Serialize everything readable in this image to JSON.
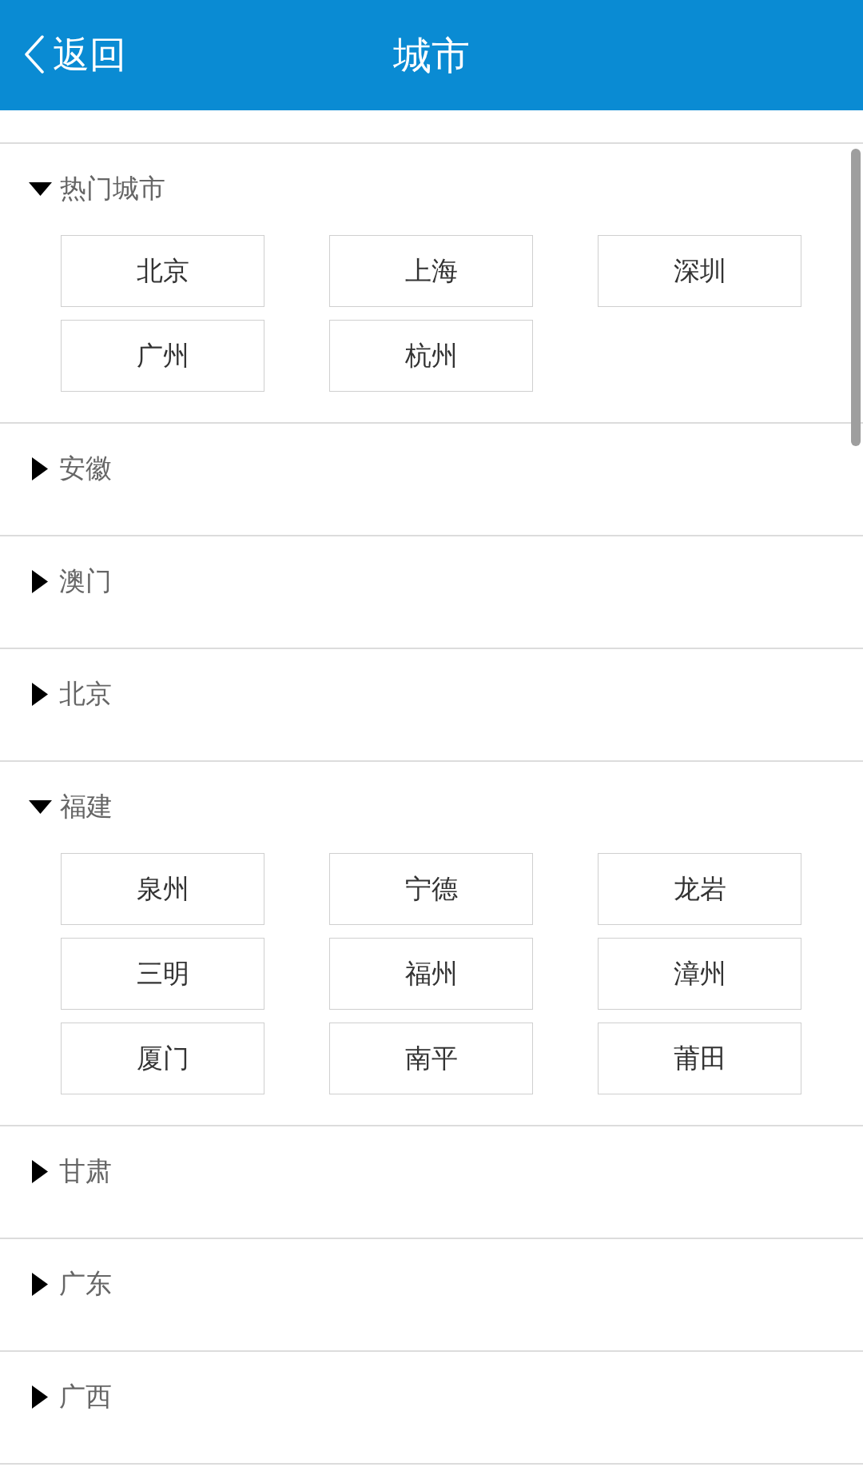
{
  "header": {
    "back_label": "返回",
    "title": "城市"
  },
  "sections": [
    {
      "title": "热门城市",
      "expanded": true,
      "cities": [
        "北京",
        "上海",
        "深圳",
        "广州",
        "杭州"
      ]
    },
    {
      "title": "安徽",
      "expanded": false
    },
    {
      "title": "澳门",
      "expanded": false
    },
    {
      "title": "北京",
      "expanded": false
    },
    {
      "title": "福建",
      "expanded": true,
      "cities": [
        "泉州",
        "宁德",
        "龙岩",
        "三明",
        "福州",
        "漳州",
        "厦门",
        "南平",
        "莆田"
      ]
    },
    {
      "title": "甘肃",
      "expanded": false
    },
    {
      "title": "广东",
      "expanded": false
    },
    {
      "title": "广西",
      "expanded": false
    }
  ]
}
